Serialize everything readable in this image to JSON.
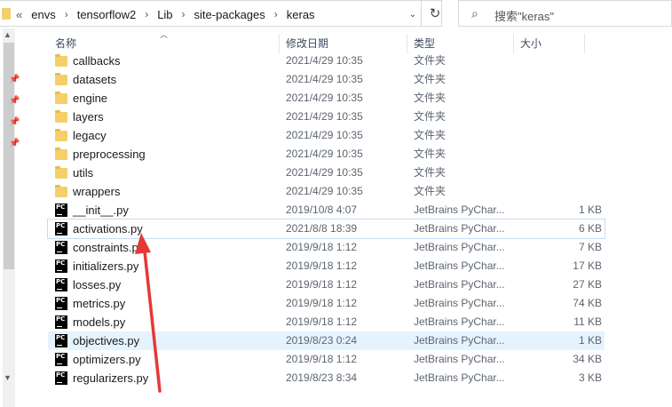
{
  "address": {
    "lead": "«",
    "crumbs": [
      "envs",
      "tensorflow2",
      "Lib",
      "site-packages",
      "keras"
    ],
    "dropdown": "⌄",
    "refresh": "↻"
  },
  "search": {
    "icon": "search-icon",
    "placeholder": "搜索\"keras\""
  },
  "columns": {
    "name": "名称",
    "date": "修改日期",
    "type": "类型",
    "size": "大小"
  },
  "files": [
    {
      "name": "callbacks",
      "date": "2021/4/29 10:35",
      "type": "文件夹",
      "size": "",
      "kind": "folder"
    },
    {
      "name": "datasets",
      "date": "2021/4/29 10:35",
      "type": "文件夹",
      "size": "",
      "kind": "folder"
    },
    {
      "name": "engine",
      "date": "2021/4/29 10:35",
      "type": "文件夹",
      "size": "",
      "kind": "folder"
    },
    {
      "name": "layers",
      "date": "2021/4/29 10:35",
      "type": "文件夹",
      "size": "",
      "kind": "folder"
    },
    {
      "name": "legacy",
      "date": "2021/4/29 10:35",
      "type": "文件夹",
      "size": "",
      "kind": "folder"
    },
    {
      "name": "preprocessing",
      "date": "2021/4/29 10:35",
      "type": "文件夹",
      "size": "",
      "kind": "folder"
    },
    {
      "name": "utils",
      "date": "2021/4/29 10:35",
      "type": "文件夹",
      "size": "",
      "kind": "folder"
    },
    {
      "name": "wrappers",
      "date": "2021/4/29 10:35",
      "type": "文件夹",
      "size": "",
      "kind": "folder"
    },
    {
      "name": "__init__.py",
      "date": "2019/10/8 4:07",
      "type": "JetBrains PyChar...",
      "size": "1 KB",
      "kind": "py"
    },
    {
      "name": "activations.py",
      "date": "2021/8/8 18:39",
      "type": "JetBrains PyChar...",
      "size": "6 KB",
      "kind": "py",
      "selected": true
    },
    {
      "name": "constraints.py",
      "date": "2019/9/18 1:12",
      "type": "JetBrains PyChar...",
      "size": "7 KB",
      "kind": "py"
    },
    {
      "name": "initializers.py",
      "date": "2019/9/18 1:12",
      "type": "JetBrains PyChar...",
      "size": "17 KB",
      "kind": "py"
    },
    {
      "name": "losses.py",
      "date": "2019/9/18 1:12",
      "type": "JetBrains PyChar...",
      "size": "27 KB",
      "kind": "py"
    },
    {
      "name": "metrics.py",
      "date": "2019/9/18 1:12",
      "type": "JetBrains PyChar...",
      "size": "74 KB",
      "kind": "py"
    },
    {
      "name": "models.py",
      "date": "2019/9/18 1:12",
      "type": "JetBrains PyChar...",
      "size": "11 KB",
      "kind": "py"
    },
    {
      "name": "objectives.py",
      "date": "2019/8/23 0:24",
      "type": "JetBrains PyChar...",
      "size": "1 KB",
      "kind": "py",
      "hover": true
    },
    {
      "name": "optimizers.py",
      "date": "2019/9/18 1:12",
      "type": "JetBrains PyChar...",
      "size": "34 KB",
      "kind": "py"
    },
    {
      "name": "regularizers.py",
      "date": "2019/8/23 8:34",
      "type": "JetBrains PyChar...",
      "size": "3 KB",
      "kind": "py"
    }
  ],
  "py_icon_text": "PC",
  "colors": {
    "folder": "#f5d06a",
    "hover": "#e5f3ff",
    "annotation_arrow": "#e53935"
  }
}
